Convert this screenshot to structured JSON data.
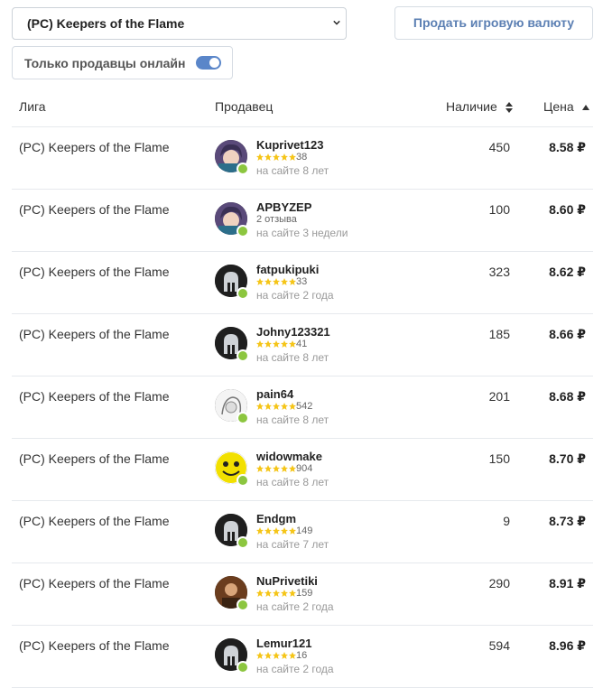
{
  "filters": {
    "league_select_value": "(PC) Keepers of the Flame",
    "sell_button_label": "Продать игровую валюту",
    "online_only_label": "Только продавцы онлайн",
    "online_only_enabled": true
  },
  "table": {
    "headers": {
      "league": "Лига",
      "seller": "Продавец",
      "stock": "Наличие",
      "price": "Цена"
    },
    "rows": [
      {
        "league": "(PC) Keepers of the Flame",
        "seller": "Kuprivet123",
        "rating_text": "38",
        "since": "на сайте 8 лет",
        "stock": "450",
        "price": "8.58 ₽",
        "avatar": "anime-avatar",
        "stars": 5
      },
      {
        "league": "(PC) Keepers of the Flame",
        "seller": "APBYZEP",
        "rating_text": "2 отзыва",
        "since": "на сайте 3 недели",
        "stock": "100",
        "price": "8.60 ₽",
        "avatar": "anime-avatar",
        "stars": 0
      },
      {
        "league": "(PC) Keepers of the Flame",
        "seller": "fatpukipuki",
        "rating_text": "33",
        "since": "на сайте 2 года",
        "stock": "323",
        "price": "8.62 ₽",
        "avatar": "helmet-avatar",
        "stars": 5
      },
      {
        "league": "(PC) Keepers of the Flame",
        "seller": "Johny123321",
        "rating_text": "41",
        "since": "на сайте 8 лет",
        "stock": "185",
        "price": "8.66 ₽",
        "avatar": "helmet-avatar",
        "stars": 5
      },
      {
        "league": "(PC) Keepers of the Flame",
        "seller": "pain64",
        "rating_text": "542",
        "since": "на сайте 8 лет",
        "stock": "201",
        "price": "8.68 ₽",
        "avatar": "sketch-avatar",
        "stars": 5
      },
      {
        "league": "(PC) Keepers of the Flame",
        "seller": "widowmake",
        "rating_text": "904",
        "since": "на сайте 8 лет",
        "stock": "150",
        "price": "8.70 ₽",
        "avatar": "smiley-avatar",
        "stars": 5
      },
      {
        "league": "(PC) Keepers of the Flame",
        "seller": "Endgm",
        "rating_text": "149",
        "since": "на сайте 7 лет",
        "stock": "9",
        "price": "8.73 ₽",
        "avatar": "helmet-avatar",
        "stars": 5
      },
      {
        "league": "(PC) Keepers of the Flame",
        "seller": "NuPrivetiki",
        "rating_text": "159",
        "since": "на сайте 2 года",
        "stock": "290",
        "price": "8.91 ₽",
        "avatar": "portrait-avatar",
        "stars": 5
      },
      {
        "league": "(PC) Keepers of the Flame",
        "seller": "Lemur121",
        "rating_text": "16",
        "since": "на сайте 2 года",
        "stock": "594",
        "price": "8.96 ₽",
        "avatar": "helmet-avatar",
        "stars": 5
      }
    ]
  },
  "colors": {
    "accent": "#5a86c9",
    "online": "#8cc63f",
    "star": "#f5c518"
  }
}
